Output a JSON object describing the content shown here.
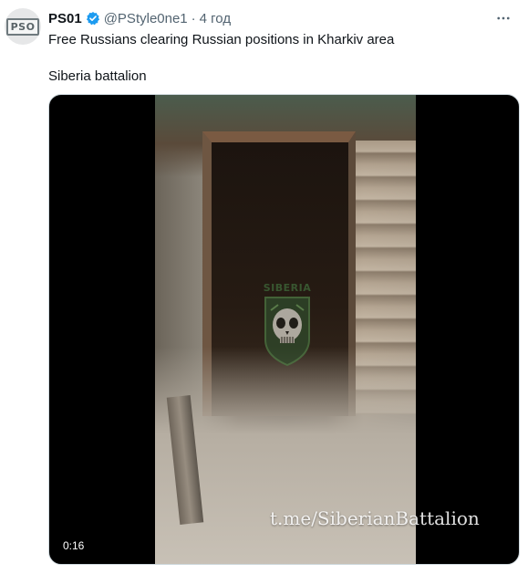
{
  "post": {
    "display_name": "PS01",
    "handle": "@PStyle0ne1",
    "separator": "·",
    "time": "4 год",
    "text_line1": "Free Russians clearing Russian positions in Kharkiv area",
    "text_line2": "Siberia battalion"
  },
  "avatar": {
    "logo_text": "PSO"
  },
  "media": {
    "watermark": "t.me/SiberianBattalion",
    "emblem_text": "SIBERIA",
    "duration": "0:16"
  },
  "icons": {
    "verified": "verified-badge-icon",
    "more": "more-options-icon"
  },
  "colors": {
    "verified_badge": "#1d9bf0",
    "secondary_text": "#536471",
    "primary_text": "#0f1419",
    "emblem_green": "#3f6b3a"
  }
}
